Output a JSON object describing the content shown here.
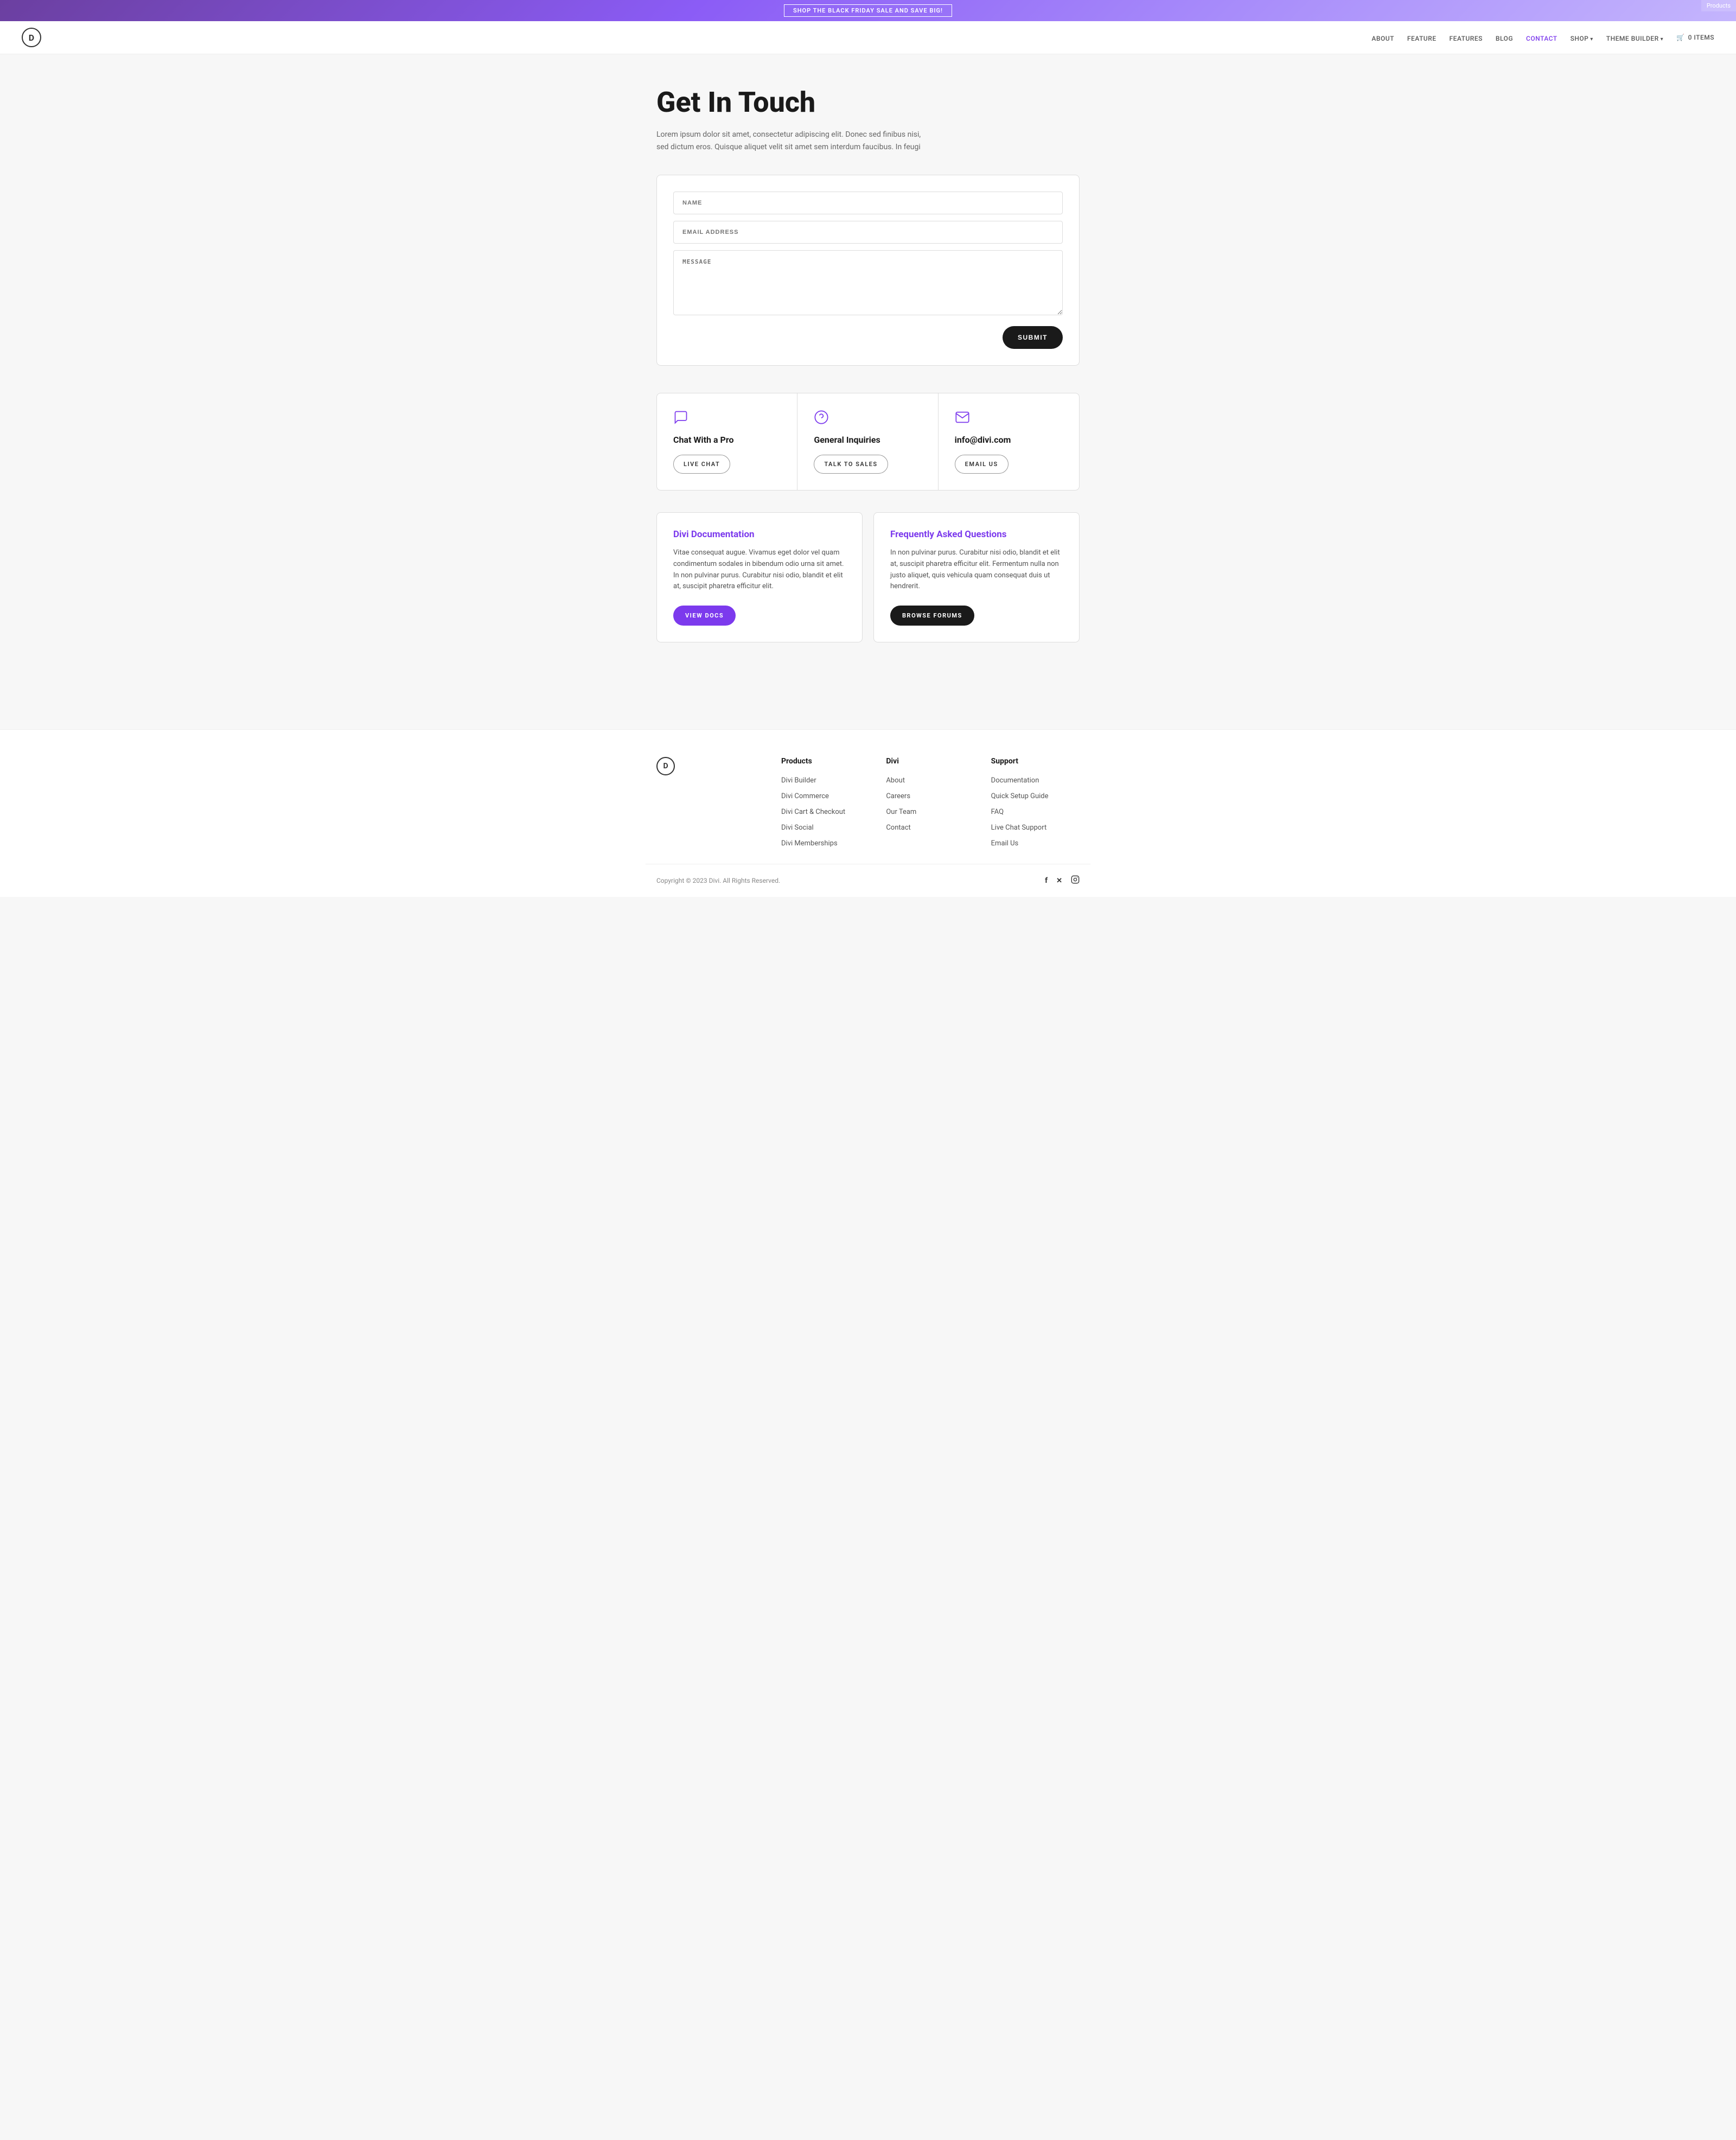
{
  "banner": {
    "text": "SHOP THE BLACK FRIDAY SALE AND SAVE BIG!",
    "products_label": "Products"
  },
  "nav": {
    "logo": "D",
    "links": [
      {
        "label": "ABOUT",
        "href": "#",
        "active": false,
        "arrow": false
      },
      {
        "label": "FEATURE",
        "href": "#",
        "active": false,
        "arrow": false
      },
      {
        "label": "FEATURES",
        "href": "#",
        "active": false,
        "arrow": false
      },
      {
        "label": "BLOG",
        "href": "#",
        "active": false,
        "arrow": false
      },
      {
        "label": "CONTACT",
        "href": "#",
        "active": true,
        "arrow": false
      },
      {
        "label": "SHOP",
        "href": "#",
        "active": false,
        "arrow": true
      },
      {
        "label": "THEME BUILDER",
        "href": "#",
        "active": false,
        "arrow": true
      }
    ],
    "cart": {
      "label": "0 ITEMS"
    }
  },
  "hero": {
    "title": "Get In Touch",
    "subtitle": "Lorem ipsum dolor sit amet, consectetur adipiscing elit. Donec sed finibus nisi, sed dictum eros. Quisque aliquet velit sit amet sem interdum faucibus. In feugi"
  },
  "form": {
    "name_placeholder": "NAME",
    "email_placeholder": "EMAIL ADDRESS",
    "message_placeholder": "MESSAGE",
    "submit_label": "SUBMIT"
  },
  "contact_cards": [
    {
      "icon": "chat",
      "title": "Chat With a Pro",
      "button": "LIVE CHAT"
    },
    {
      "icon": "question",
      "title": "General Inquiries",
      "button": "TALK TO SALES"
    },
    {
      "icon": "email",
      "title": "info@divi.com",
      "button": "EMAIL US"
    }
  ],
  "docs_cards": [
    {
      "title": "Divi Documentation",
      "text": "Vitae consequat augue. Vivamus eget dolor vel quam condimentum sodales in bibendum odio urna sit amet. In non pulvinar purus. Curabitur nisi odio, blandit et elit at, suscipit pharetra efficitur elit.",
      "button": "VIEW DOCS",
      "dark": false
    },
    {
      "title": "Frequently Asked Questions",
      "text": "In non pulvinar purus. Curabitur nisi odio, blandit et elit at, suscipit pharetra efficitur elit. Fermentum nulla non justo aliquet, quis vehicula quam consequat duis ut hendrerit.",
      "button": "BROWSE FORUMS",
      "dark": true
    }
  ],
  "footer": {
    "logo": "D",
    "columns": [
      {
        "title": "Products",
        "links": [
          "Divi Builder",
          "Divi Commerce",
          "Divi Cart & Checkout",
          "Divi Social",
          "Divi Memberships"
        ]
      },
      {
        "title": "Divi",
        "links": [
          "About",
          "Careers",
          "Our Team",
          "Contact"
        ]
      },
      {
        "title": "Support",
        "links": [
          "Documentation",
          "Quick Setup Guide",
          "FAQ",
          "Live Chat Support",
          "Email Us"
        ]
      }
    ],
    "copyright": "Copyright © 2023 Divi. All Rights Reserved.",
    "social": [
      {
        "label": "f",
        "name": "facebook"
      },
      {
        "label": "𝕏",
        "name": "twitter-x"
      },
      {
        "label": "⬡",
        "name": "instagram"
      }
    ]
  }
}
